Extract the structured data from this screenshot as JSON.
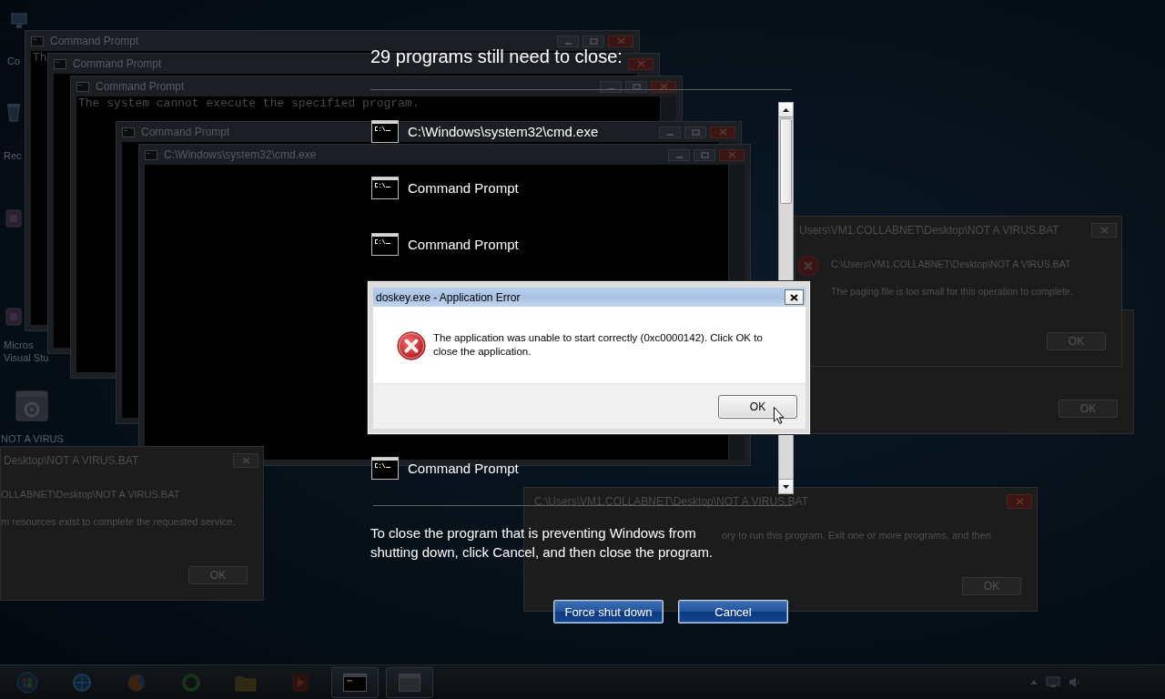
{
  "desktop": {
    "icons": [
      {
        "kind": "computer",
        "label_lines": [
          "Co"
        ]
      },
      {
        "kind": "bin",
        "label_lines": [
          "Rec"
        ]
      },
      {
        "kind": "app"
      },
      {
        "kind": "app",
        "label_lines": [
          "Micros",
          "Visual Stu"
        ]
      },
      {
        "kind": "script",
        "label_lines": [
          "NOT A VIRUS"
        ]
      }
    ],
    "console_windows": [
      {
        "title": "Command Prompt",
        "lines": [
          "Th"
        ]
      },
      {
        "title": "Command Prompt"
      },
      {
        "title": "Command Prompt",
        "lines": [
          "The system cannot execute the specified program."
        ]
      },
      {
        "title": "Command Prompt"
      },
      {
        "title": "C:\\Windows\\system32\\cmd.exe"
      }
    ],
    "message_boxes": [
      {
        "title": "Users\\VM1.COLLABNET\\Desktop\\NOT A VIRUS.BAT",
        "lines": [
          "C:\\Users\\VM1.COLLABNET\\Desktop\\NOT A VIRUS.BAT",
          "The paging file is too small for this operation to complete."
        ],
        "button": "OK",
        "focused": false
      },
      {
        "button": "OK"
      },
      {
        "title": "Desktop\\NOT A VIRUS.BAT",
        "lines": [
          "OLLABNET\\Desktop\\NOT A VIRUS.BAT",
          "m resources exist to complete the requested service."
        ],
        "button": "OK",
        "focused": false
      },
      {
        "title": "C:\\Users\\VM1.COLLABNET\\Desktop\\NOT A VIRUS.BAT",
        "lines": [
          "ory to run this program. Exit one or more programs, and then"
        ],
        "button": "OK",
        "focused": true
      }
    ]
  },
  "shutdown_screen": {
    "heading": "29 programs still need to close:",
    "programs": [
      {
        "name": "C:\\Windows\\system32\\cmd.exe"
      },
      {
        "name": "Command Prompt"
      },
      {
        "name": "Command Prompt"
      },
      {
        "name": "Command Prompt"
      }
    ],
    "message": "To close the program that is preventing Windows from shutting down, click Cancel, and then close the program.",
    "buttons": [
      "Force shut down",
      "Cancel"
    ]
  },
  "error_dialog": {
    "title": "doskey.exe - Application Error",
    "message": "The application was unable to start correctly (0xc0000142). Click OK to close the application.",
    "button": "OK"
  },
  "taskbar": {
    "buttons": [
      {
        "kind": "orb",
        "running": false
      },
      {
        "kind": "globe",
        "running": false
      },
      {
        "kind": "fox",
        "running": false
      },
      {
        "kind": "ring",
        "running": false
      },
      {
        "kind": "folder",
        "running": false
      },
      {
        "kind": "player",
        "running": false
      },
      {
        "kind": "console",
        "running": true
      },
      {
        "kind": "window",
        "running": true
      }
    ]
  }
}
